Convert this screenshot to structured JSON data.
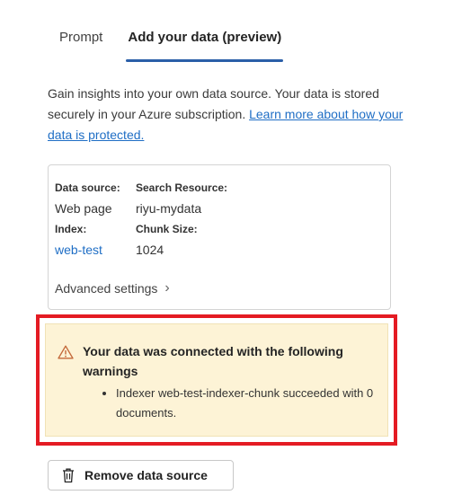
{
  "tabs": [
    {
      "label": "Prompt",
      "active": false
    },
    {
      "label": "Add your data (preview)",
      "active": true
    }
  ],
  "description": {
    "text": "Gain insights into your own data source. Your data is stored securely in your Azure subscription.",
    "link": "Learn more about how your data is protected."
  },
  "source_card": {
    "data_source_label": "Data source:",
    "data_source_value": "Web page",
    "search_resource_label": "Search Resource:",
    "search_resource_value": "riyu-mydata",
    "index_label": "Index:",
    "index_value": "web-test",
    "chunk_size_label": "Chunk Size:",
    "chunk_size_value": "1024",
    "advanced_settings": "Advanced settings"
  },
  "warning": {
    "title": "Your data was connected with the following warnings",
    "items": [
      "Indexer web-test-indexer-chunk succeeded with 0 documents."
    ],
    "highlight_color": "#e41b23",
    "background_color": "#fdf3d6"
  },
  "remove_button": {
    "label": "Remove data source"
  }
}
